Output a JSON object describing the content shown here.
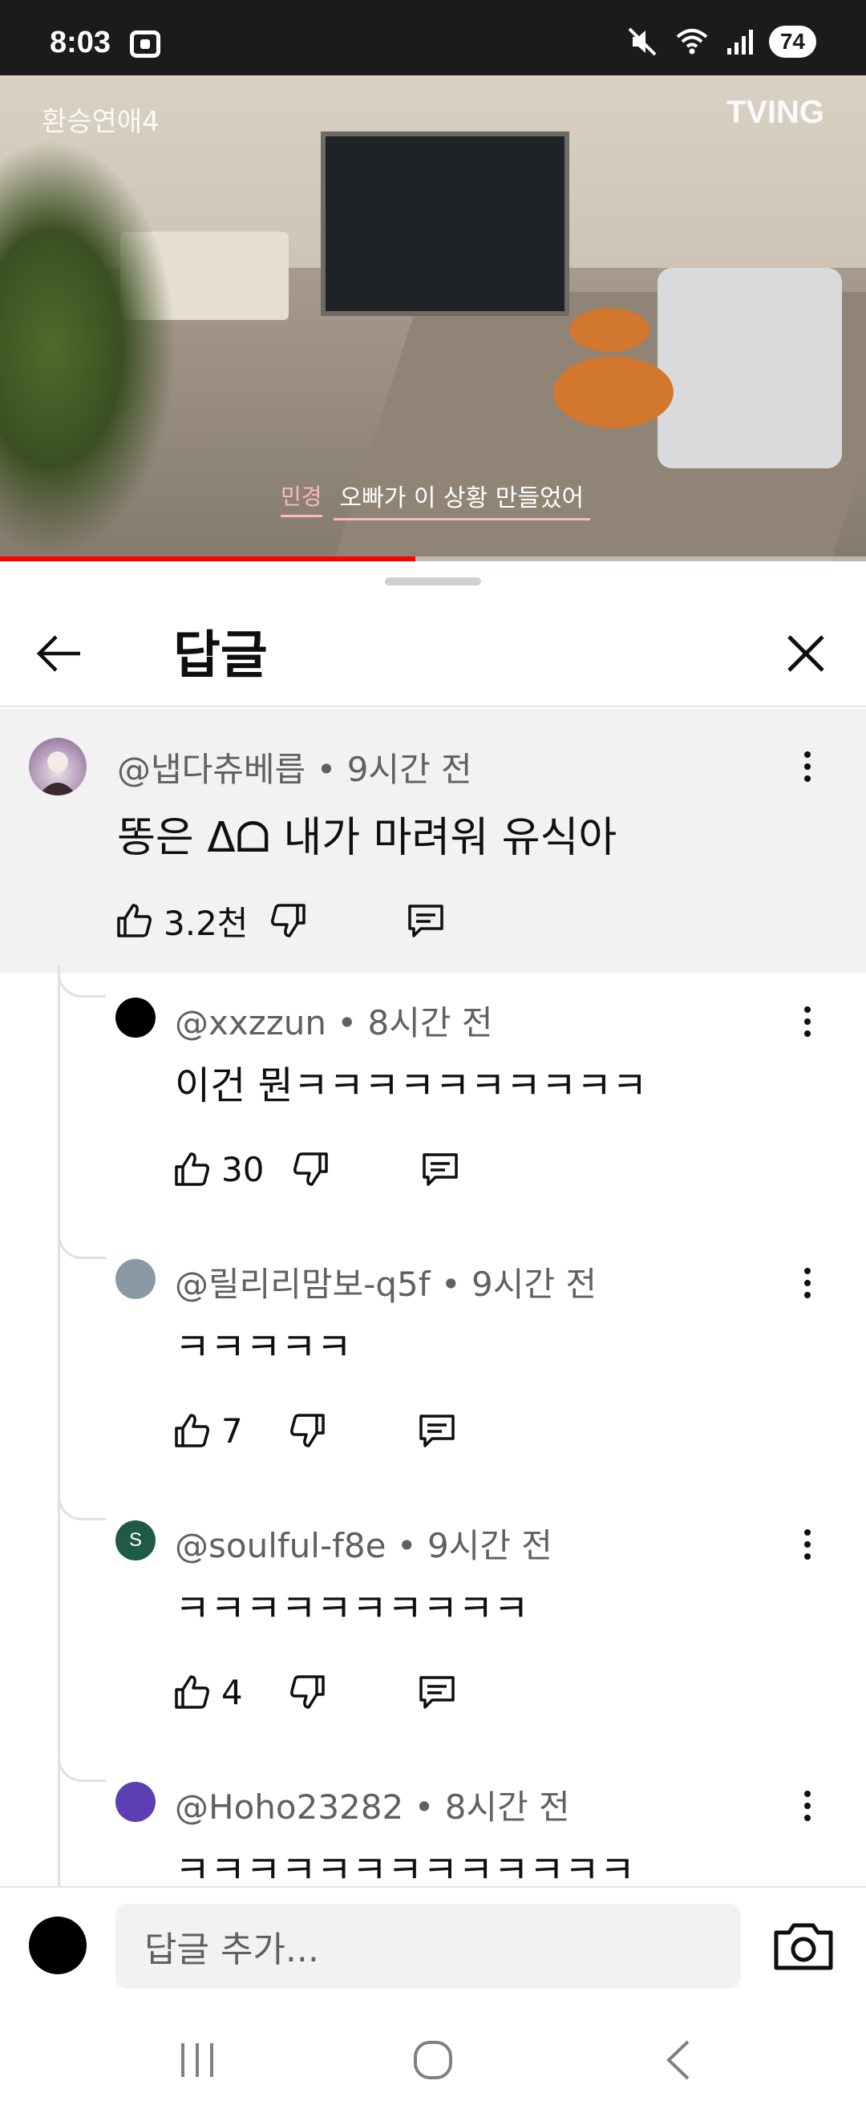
{
  "status_bar": {
    "time": "8:03",
    "battery": "74"
  },
  "video": {
    "show_title": "환승연애4",
    "brand": "TVING",
    "subtitle_speaker": "민경",
    "subtitle_text": "오빠가 이 상황 만들었어",
    "progress_fraction": 0.48
  },
  "sheet": {
    "title": "답글"
  },
  "parent_comment": {
    "author": "@냅다츄베릅",
    "time": "9시간 전",
    "text": "똥은 ᐃᗝ 내가 마려워 유식아",
    "likes": "3.2천"
  },
  "replies": [
    {
      "author": "@xxzzun",
      "time": "8시간 전",
      "text": "이건 뭔ㅋㅋㅋㅋㅋㅋㅋㅋㅋㅋ",
      "likes": "30",
      "avatar_color": "#000000",
      "avatar_letter": ""
    },
    {
      "author": "@릴리리맘보-q5f",
      "time": "9시간 전",
      "text": "ㅋㅋㅋㅋㅋ",
      "likes": "7",
      "avatar_color": "#8a9aa4",
      "avatar_letter": ""
    },
    {
      "author": "@soulful-f8e",
      "time": "9시간 전",
      "text": "ㅋㅋㅋㅋㅋㅋㅋㅋㅋㅋ",
      "likes": "4",
      "avatar_color": "#1e5a46",
      "avatar_letter": "S"
    },
    {
      "author": "@Hoho23282",
      "time": "8시간 전",
      "text": "ㅋㅋㅋㅋㅋㅋㅋㅋㅋㅋㅋㅋㅋ",
      "likes": "",
      "avatar_color": "#5b3fb3",
      "avatar_letter": ""
    }
  ],
  "composer": {
    "placeholder": "답글 추가..."
  },
  "separator": "•"
}
